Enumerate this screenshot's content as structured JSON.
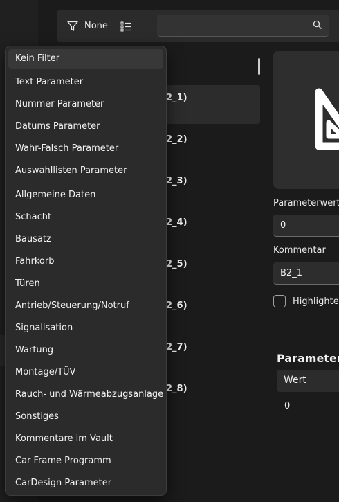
{
  "toolbar": {
    "filter_label": "None",
    "search_value": ""
  },
  "menu": {
    "items": [
      {
        "label": "Kein Filter"
      },
      {
        "label": "Text Parameter"
      },
      {
        "label": "Nummer Parameter"
      },
      {
        "label": "Datums Parameter"
      },
      {
        "label": "Wahr-Falsch Parameter"
      },
      {
        "label": "Auswahllisten Parameter"
      },
      {
        "label": "Allgemeine Daten"
      },
      {
        "label": "Schacht"
      },
      {
        "label": "Bausatz"
      },
      {
        "label": "Fahrkorb"
      },
      {
        "label": "Türen"
      },
      {
        "label": "Antrieb/Steuerung/Notruf"
      },
      {
        "label": "Signalisation"
      },
      {
        "label": "Wartung"
      },
      {
        "label": "Montage/TÜV"
      },
      {
        "label": "Rauch- und Wärmeabzugsanlage"
      },
      {
        "label": "Sonstiges"
      },
      {
        "label": "Kommentare im Vault"
      },
      {
        "label": "Car Frame Programm"
      },
      {
        "label": "CarDesign Parameter"
      }
    ]
  },
  "list": {
    "visible_fragments": [
      "2_1)",
      "2_2)",
      "2_3)",
      "2_4)",
      "2_5)",
      "2_6)",
      "2_7)",
      "2_8)"
    ]
  },
  "detail": {
    "parameterwert_label": "Parameterwert",
    "parameterwert_value": "0",
    "kommentar_label": "Kommentar",
    "kommentar_value": "B2_1",
    "highlighted_label": "Highlighted",
    "section_title": "Parameter",
    "table_header": "Wert",
    "table_value": "0"
  }
}
